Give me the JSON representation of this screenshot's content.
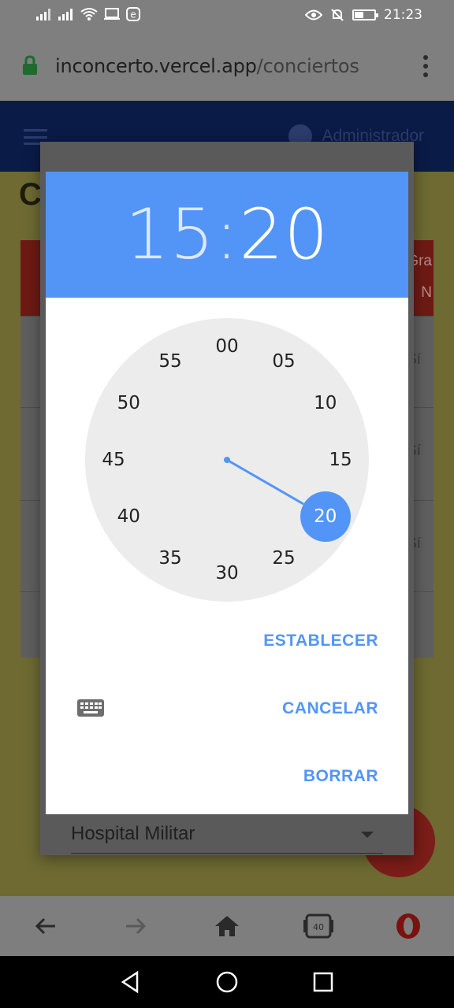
{
  "status_bar": {
    "time": "21:23"
  },
  "browser": {
    "url_domain": "inconcerto.vercel.app",
    "url_path": "/conciertos",
    "tab_count": "40"
  },
  "app": {
    "user_label": "Administrador",
    "page_heading": "C",
    "column_headers": [
      "Gra",
      "N"
    ],
    "cell_values": [
      "Sí",
      "Sí",
      "Sí"
    ],
    "venue_field_value": "Hospital Militar"
  },
  "time_picker": {
    "hours": "15",
    "separator": ":",
    "minutes": "20",
    "selected_minute": "20",
    "dial_numbers": [
      "00",
      "05",
      "10",
      "15",
      "20",
      "25",
      "30",
      "35",
      "40",
      "45",
      "50",
      "55"
    ],
    "actions": {
      "set": "ESTABLECER",
      "cancel": "CANCELAR",
      "clear": "BORRAR"
    }
  },
  "colors": {
    "accent": "#5295f7",
    "dial_background": "#ececec",
    "app_header": "#0b1b48",
    "fab": "#7b1d18"
  },
  "icons": [
    "lock-icon",
    "kebab-icon",
    "hamburger-icon",
    "avatar-icon",
    "keyboard-icon",
    "dropdown-icon",
    "back-icon",
    "forward-icon",
    "home-icon",
    "tabs-icon",
    "opera-icon"
  ]
}
